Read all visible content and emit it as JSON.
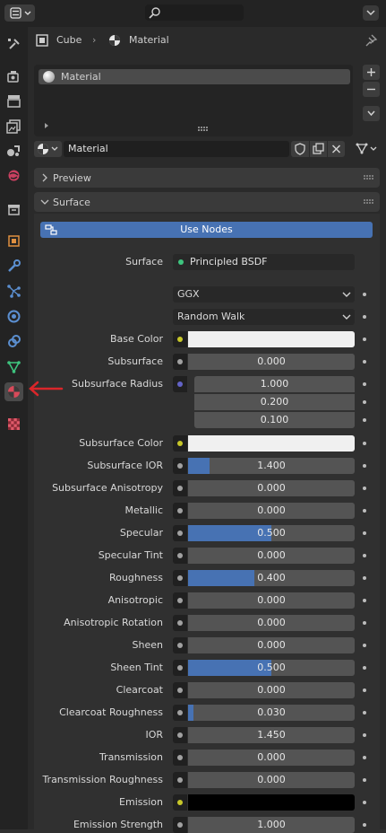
{
  "header": {
    "object_name": "Cube",
    "material_name": "Material"
  },
  "slots": {
    "items": [
      "Material"
    ]
  },
  "material_selector": {
    "value": "Material"
  },
  "panels": {
    "preview": "Preview",
    "surface": "Surface"
  },
  "surface": {
    "use_nodes_label": "Use Nodes",
    "surface_label": "Surface",
    "surface_value": "Principled BSDF",
    "distribution": "GGX",
    "subsurface_method": "Random Walk"
  },
  "properties": [
    {
      "label": "Base Color",
      "kind": "color",
      "color": "#f0f0f0",
      "socket": "#c7c729"
    },
    {
      "label": "Subsurface",
      "kind": "slider",
      "value": "0.000",
      "fraction": 0.0,
      "socket": "#a1a1a1"
    },
    {
      "label": "Subsurface Radius",
      "kind": "vector",
      "values": [
        "1.000",
        "0.200",
        "0.100"
      ],
      "socket": "#6363c7"
    },
    {
      "label": "Subsurface Color",
      "kind": "color",
      "color": "#f0f0f0",
      "socket": "#c7c729"
    },
    {
      "label": "Subsurface IOR",
      "kind": "slider",
      "value": "1.400",
      "fraction": 0.13,
      "socket": "#a1a1a1"
    },
    {
      "label": "Subsurface Anisotropy",
      "kind": "slider",
      "value": "0.000",
      "fraction": 0.0,
      "socket": "#a1a1a1"
    },
    {
      "label": "Metallic",
      "kind": "slider",
      "value": "0.000",
      "fraction": 0.0,
      "socket": "#a1a1a1"
    },
    {
      "label": "Specular",
      "kind": "slider",
      "value": "0.500",
      "fraction": 0.5,
      "socket": "#a1a1a1"
    },
    {
      "label": "Specular Tint",
      "kind": "slider",
      "value": "0.000",
      "fraction": 0.0,
      "socket": "#a1a1a1"
    },
    {
      "label": "Roughness",
      "kind": "slider",
      "value": "0.400",
      "fraction": 0.4,
      "socket": "#a1a1a1"
    },
    {
      "label": "Anisotropic",
      "kind": "slider",
      "value": "0.000",
      "fraction": 0.0,
      "socket": "#a1a1a1"
    },
    {
      "label": "Anisotropic Rotation",
      "kind": "slider",
      "value": "0.000",
      "fraction": 0.0,
      "socket": "#a1a1a1"
    },
    {
      "label": "Sheen",
      "kind": "slider",
      "value": "0.000",
      "fraction": 0.0,
      "socket": "#a1a1a1"
    },
    {
      "label": "Sheen Tint",
      "kind": "slider",
      "value": "0.500",
      "fraction": 0.5,
      "socket": "#a1a1a1"
    },
    {
      "label": "Clearcoat",
      "kind": "slider",
      "value": "0.000",
      "fraction": 0.0,
      "socket": "#a1a1a1"
    },
    {
      "label": "Clearcoat Roughness",
      "kind": "slider",
      "value": "0.030",
      "fraction": 0.03,
      "socket": "#a1a1a1"
    },
    {
      "label": "IOR",
      "kind": "slider",
      "value": "1.450",
      "fraction": 0.0,
      "socket": "#a1a1a1"
    },
    {
      "label": "Transmission",
      "kind": "slider",
      "value": "0.000",
      "fraction": 0.0,
      "socket": "#a1a1a1"
    },
    {
      "label": "Transmission Roughness",
      "kind": "slider",
      "value": "0.000",
      "fraction": 0.0,
      "socket": "#a1a1a1"
    },
    {
      "label": "Emission",
      "kind": "color",
      "color": "#000000",
      "socket": "#c7c729"
    },
    {
      "label": "Emission Strength",
      "kind": "slider",
      "value": "1.000",
      "fraction": 0.0,
      "socket": "#a1a1a1"
    }
  ],
  "tabs": [
    "tool-icon",
    "render-icon",
    "output-icon",
    "view-layer-icon",
    "scene-icon",
    "world-icon",
    "collection-icon",
    "object-icon",
    "modifier-icon",
    "particles-icon",
    "physics-icon",
    "constraints-icon",
    "data-icon",
    "material-icon",
    "texture-icon"
  ],
  "colors": {
    "accent": "#4772b3",
    "annotation_arrow": "#d9262a"
  }
}
